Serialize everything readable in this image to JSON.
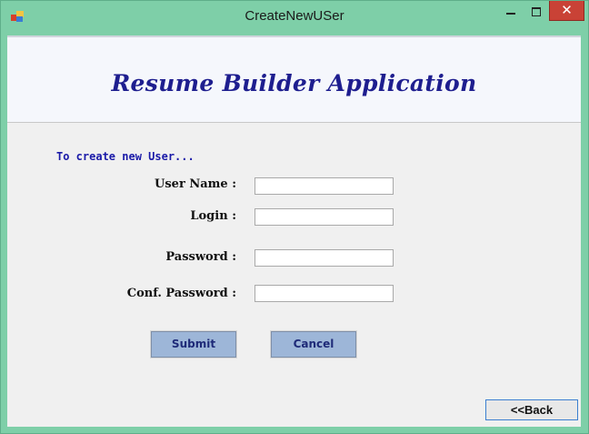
{
  "window": {
    "title": "CreateNewUSer",
    "controls": {
      "minimize": "minimize",
      "maximize": "maximize",
      "close": "✕"
    }
  },
  "banner": {
    "title": "Resume Builder Application"
  },
  "form": {
    "intro": "To create new User...",
    "fields": [
      {
        "label": "User Name :",
        "value": ""
      },
      {
        "label": "Login :",
        "value": ""
      },
      {
        "label": "Password :",
        "value": ""
      },
      {
        "label": "Conf. Password :",
        "value": ""
      }
    ],
    "submit_label": "Submit",
    "cancel_label": "Cancel",
    "back_label": "<<Back"
  },
  "colors": {
    "titlebar": "#7ecfa8",
    "close_button": "#c94236",
    "banner_text": "#1e1e8f",
    "intro_text": "#1a1aa8",
    "button_face": "#9db6d8"
  }
}
